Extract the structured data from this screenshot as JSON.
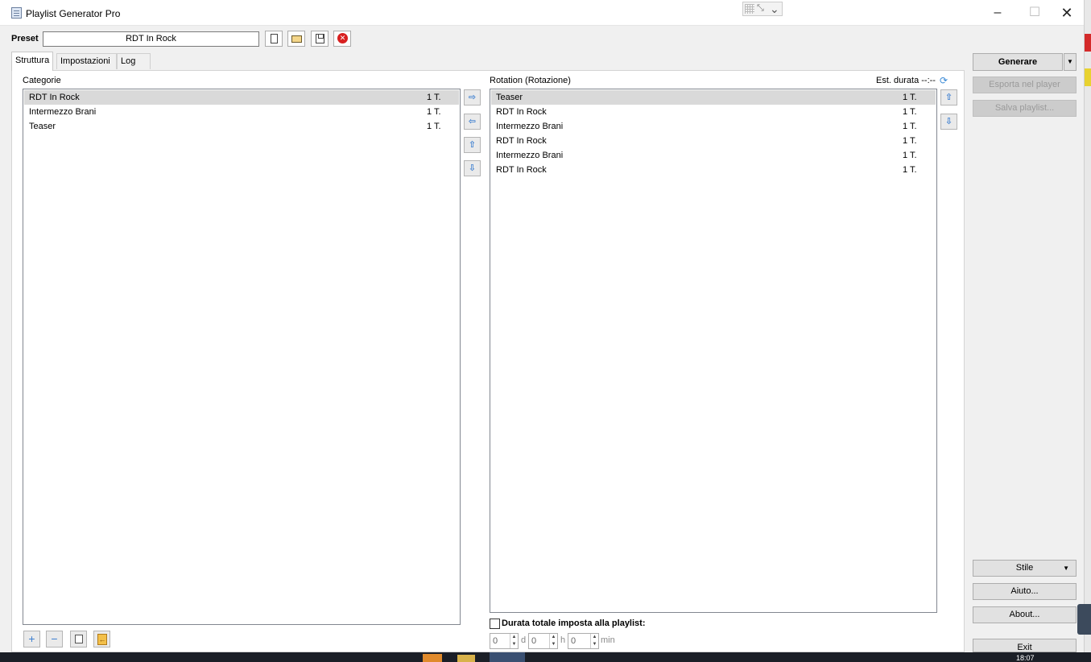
{
  "window": {
    "title": "Playlist Generator Pro",
    "min_glyph": "–",
    "max_glyph": "☐",
    "close_glyph": "✕"
  },
  "preset": {
    "label": "Preset",
    "value": "RDT In Rock"
  },
  "tabs": [
    {
      "label": "Struttura",
      "active": true
    },
    {
      "label": "Impostazioni",
      "active": false
    },
    {
      "label": "Log",
      "active": false
    }
  ],
  "categorie": {
    "label": "Categorie",
    "items": [
      {
        "name": "RDT In Rock",
        "count": "1 T.",
        "selected": true
      },
      {
        "name": "Intermezzo Brani",
        "count": "1 T.",
        "selected": false
      },
      {
        "name": "Teaser",
        "count": "1 T.",
        "selected": false
      }
    ]
  },
  "rotation": {
    "label": "Rotation (Rotazione)",
    "est_durata": "Est. durata --:--",
    "items": [
      {
        "name": "Teaser",
        "count": "1 T.",
        "selected": true
      },
      {
        "name": "RDT In Rock",
        "count": "1 T.",
        "selected": false
      },
      {
        "name": "Intermezzo Brani",
        "count": "1 T.",
        "selected": false
      },
      {
        "name": "RDT In Rock",
        "count": "1 T.",
        "selected": false
      },
      {
        "name": "Intermezzo Brani",
        "count": "1 T.",
        "selected": false
      },
      {
        "name": "RDT In Rock",
        "count": "1 T.",
        "selected": false
      }
    ]
  },
  "durata": {
    "label": "Durata totale imposta alla playlist:",
    "checked": false,
    "days": "0",
    "hours": "0",
    "minutes": "0",
    "unit_d": "d",
    "unit_h": "h",
    "unit_m": "min"
  },
  "actions": {
    "generare": "Generare",
    "esporta": "Esporta nel player",
    "salva": "Salva playlist...",
    "stile": "Stile",
    "aiuto": "Aiuto...",
    "about": "About...",
    "exit": "Exit"
  },
  "taskbar": {
    "clock": "18:07"
  },
  "colors": {
    "selection": "#d9d9d9",
    "arrow_blue": "#3d7fd0",
    "delete_red": "#d82020"
  }
}
